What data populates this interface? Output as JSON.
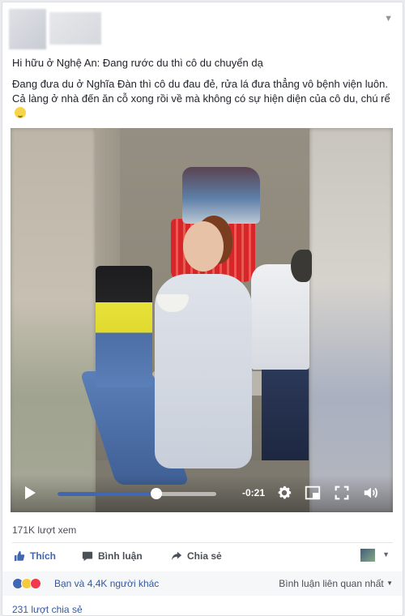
{
  "post": {
    "title": "Hi hữu ở Nghệ An: Đang rước du thì cô du chuyển dạ",
    "body": "Đang đưa du ở Nghĩa Đàn thì cô du đau đẻ, rửa lá đưa thẳng vô bệnh viện luôn. Cả làng ở nhà đến ăn cỗ xong rồi về mà không có sự hiện diện của cô du, chú rể"
  },
  "video": {
    "time_remaining": "-0:21",
    "progress_fraction": 0.62,
    "icons": [
      "play-icon",
      "gear-icon",
      "pip-icon",
      "fullscreen-icon",
      "volume-icon"
    ]
  },
  "stats": {
    "views": "171K lượt xem",
    "reactions_text": "Bạn và 4,4K người khác",
    "relevant_comments": "Bình luận liên quan nhất",
    "shares": "231 lượt chia sẻ"
  },
  "actions": {
    "like": "Thích",
    "comment": "Bình luận",
    "share": "Chia sẻ"
  },
  "colors": {
    "accent": "#4267b2",
    "link": "#365899"
  }
}
